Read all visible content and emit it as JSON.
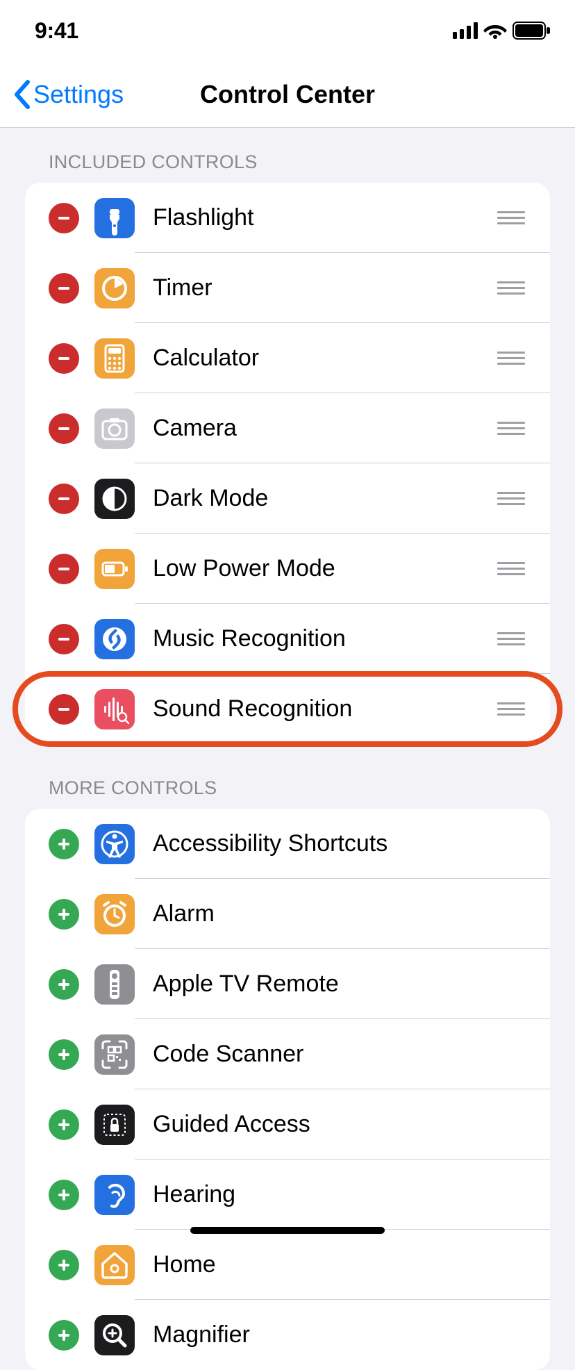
{
  "status": {
    "time": "9:41"
  },
  "nav": {
    "back_label": "Settings",
    "title": "Control Center"
  },
  "sections": {
    "included": {
      "header": "Included Controls",
      "items": [
        {
          "label": "Flashlight",
          "icon": "flashlight-icon",
          "icon_bg": "bg-blue"
        },
        {
          "label": "Timer",
          "icon": "timer-icon",
          "icon_bg": "bg-orange"
        },
        {
          "label": "Calculator",
          "icon": "calculator-icon",
          "icon_bg": "bg-orange"
        },
        {
          "label": "Camera",
          "icon": "camera-icon",
          "icon_bg": "bg-lgray"
        },
        {
          "label": "Dark Mode",
          "icon": "dark-mode-icon",
          "icon_bg": "bg-dark"
        },
        {
          "label": "Low Power Mode",
          "icon": "low-power-icon",
          "icon_bg": "bg-orange"
        },
        {
          "label": "Music Recognition",
          "icon": "shazam-icon",
          "icon_bg": "bg-blue"
        },
        {
          "label": "Sound Recognition",
          "icon": "sound-recog-icon",
          "icon_bg": "bg-red",
          "highlighted": true
        }
      ]
    },
    "more": {
      "header": "More Controls",
      "items": [
        {
          "label": "Accessibility Shortcuts",
          "icon": "accessibility-icon",
          "icon_bg": "bg-blue"
        },
        {
          "label": "Alarm",
          "icon": "alarm-icon",
          "icon_bg": "bg-orange"
        },
        {
          "label": "Apple TV Remote",
          "icon": "remote-icon",
          "icon_bg": "bg-gray"
        },
        {
          "label": "Code Scanner",
          "icon": "qr-icon",
          "icon_bg": "bg-gray"
        },
        {
          "label": "Guided Access",
          "icon": "guided-icon",
          "icon_bg": "bg-dark"
        },
        {
          "label": "Hearing",
          "icon": "hearing-icon",
          "icon_bg": "bg-blue"
        },
        {
          "label": "Home",
          "icon": "home-icon",
          "icon_bg": "bg-orange"
        },
        {
          "label": "Magnifier",
          "icon": "magnifier-icon",
          "icon_bg": "bg-dark"
        }
      ]
    }
  }
}
